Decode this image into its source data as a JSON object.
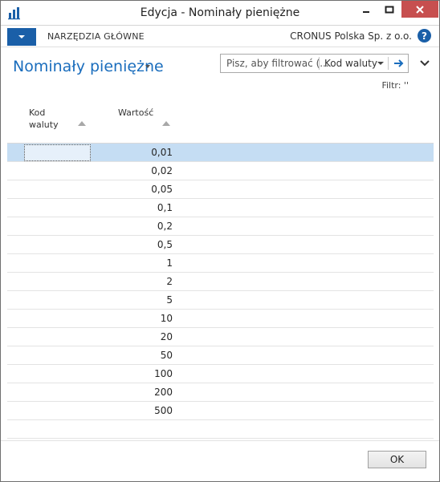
{
  "window": {
    "title": "Edycja - Nominały pieniężne"
  },
  "ribbon": {
    "tab_home": "NARZĘDZIA GŁÓWNE",
    "company": "CRONUS Polska Sp. z o.o.",
    "help": "?"
  },
  "page": {
    "title": "Nominały pieniężne"
  },
  "filter": {
    "placeholder": "Pisz, aby filtrować (...",
    "field": "Kod waluty",
    "status": "Filtr: ''"
  },
  "table": {
    "columns": {
      "code_line1": "Kod",
      "code_line2": "waluty",
      "value": "Wartość"
    },
    "rows": [
      {
        "code": "",
        "value": "0,01"
      },
      {
        "code": "",
        "value": "0,02"
      },
      {
        "code": "",
        "value": "0,05"
      },
      {
        "code": "",
        "value": "0,1"
      },
      {
        "code": "",
        "value": "0,2"
      },
      {
        "code": "",
        "value": "0,5"
      },
      {
        "code": "",
        "value": "1"
      },
      {
        "code": "",
        "value": "2"
      },
      {
        "code": "",
        "value": "5"
      },
      {
        "code": "",
        "value": "10"
      },
      {
        "code": "",
        "value": "20"
      },
      {
        "code": "",
        "value": "50"
      },
      {
        "code": "",
        "value": "100"
      },
      {
        "code": "",
        "value": "200"
      },
      {
        "code": "",
        "value": "500"
      }
    ]
  },
  "footer": {
    "ok_label": "OK"
  },
  "colors": {
    "accent": "#1a6dbd",
    "file_button": "#1a5fa8",
    "selected_row": "#c5ddf3",
    "close_button": "#c74f4f"
  }
}
